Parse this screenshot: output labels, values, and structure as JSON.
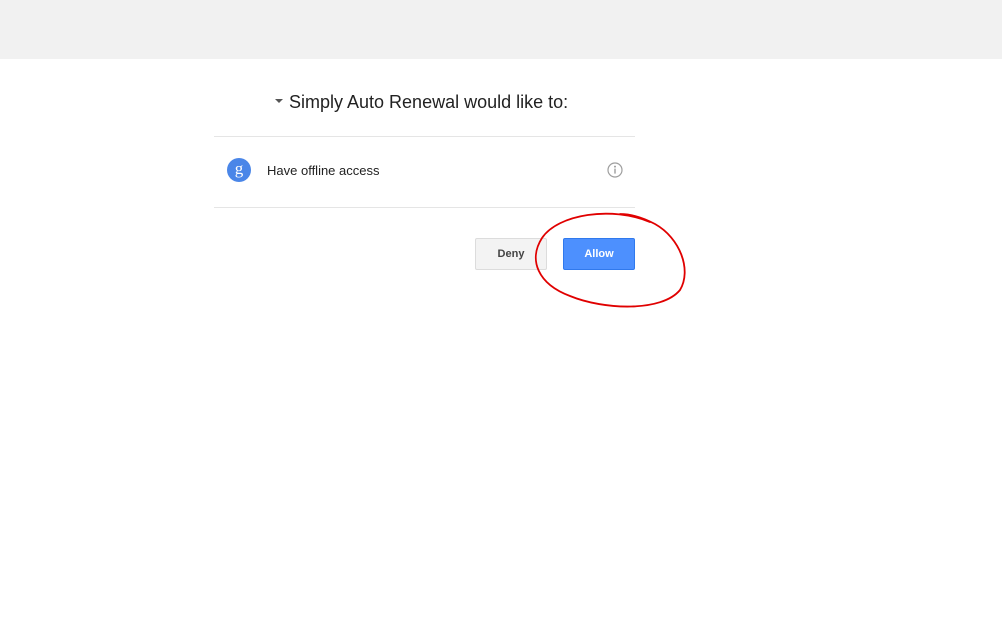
{
  "dialog": {
    "title": "Simply Auto Renewal would like to:",
    "permissions": [
      {
        "icon": "google-g-icon",
        "label": "Have offline access",
        "info_icon": "info-icon"
      }
    ]
  },
  "actions": {
    "deny_label": "Deny",
    "allow_label": "Allow"
  },
  "colors": {
    "allow_button": "#4d90fe",
    "google_icon": "#4a86e8",
    "annotation": "#e00000",
    "top_bar": "#f1f1f1"
  }
}
